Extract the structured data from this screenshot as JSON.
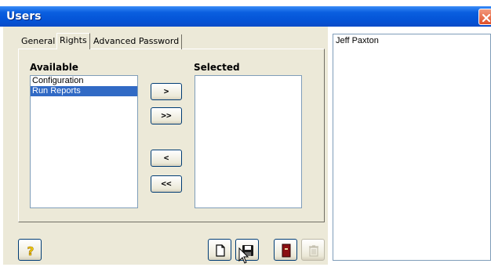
{
  "window": {
    "title": "Users"
  },
  "tabs": [
    {
      "label": "General"
    },
    {
      "label": "Rights",
      "active": true
    },
    {
      "label": "Advanced Password"
    }
  ],
  "rights": {
    "available_label": "Available",
    "selected_label": "Selected",
    "available_items": [
      {
        "label": "Configuration",
        "selected": false
      },
      {
        "label": "Run Reports",
        "selected": true
      }
    ],
    "selected_items": [],
    "buttons": {
      "add": ">",
      "add_all": ">>",
      "remove": "<",
      "remove_all": "<<"
    }
  },
  "toolbar": {
    "help_icon": "question-mark-icon",
    "new_icon": "new-document-icon",
    "save_icon": "floppy-disk-icon",
    "exit_icon": "exit-door-icon",
    "delete_icon": "trash-can-icon"
  },
  "users_list": [
    "Jeff Paxton"
  ],
  "colors": {
    "titlebar": "#0453d6",
    "panel": "#ece9d8",
    "selection": "#316ac5",
    "close": "#e0502a"
  }
}
